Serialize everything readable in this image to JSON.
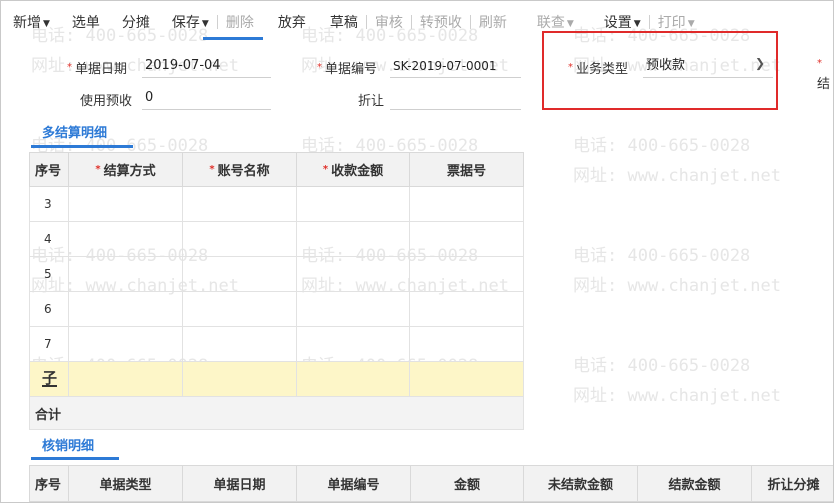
{
  "toolbar": {
    "items": [
      {
        "label": "新增",
        "caret": true,
        "disabled": false
      },
      {
        "label": "选单",
        "caret": false,
        "disabled": false
      },
      {
        "label": "分摊",
        "caret": false,
        "disabled": false
      },
      {
        "label": "保存",
        "caret": true,
        "disabled": false
      },
      {
        "label": "删除",
        "caret": false,
        "disabled": true
      },
      {
        "label": "放弃",
        "caret": false,
        "disabled": false
      },
      {
        "label": "草稿",
        "caret": false,
        "disabled": false
      },
      {
        "label": "审核",
        "caret": false,
        "disabled": true
      },
      {
        "label": "转预收",
        "caret": false,
        "disabled": true
      },
      {
        "label": "刷新",
        "caret": false,
        "disabled": true
      },
      {
        "label": "联查",
        "caret": true,
        "disabled": true
      },
      {
        "label": "设置",
        "caret": true,
        "disabled": false
      },
      {
        "label": "打印",
        "caret": true,
        "disabled": true
      }
    ]
  },
  "form": {
    "date_label": "单据日期",
    "date_value": "2019-07-04",
    "number_label": "单据编号",
    "number_value": "SK-2019-07-0001",
    "biz_type_label": "业务类型",
    "biz_type_value": "预收款",
    "use_prepay_label": "使用预收",
    "use_prepay_value": "0",
    "discount_label": "折让",
    "discount_value": "",
    "cut_label": "结"
  },
  "settlement": {
    "title": "多结算明细",
    "columns": [
      {
        "label": "序号",
        "required": false
      },
      {
        "label": "结算方式",
        "required": true
      },
      {
        "label": "账号名称",
        "required": true
      },
      {
        "label": "收款金额",
        "required": true
      },
      {
        "label": "票据号",
        "required": false
      }
    ],
    "rows": [
      "3",
      "4",
      "5",
      "6",
      "7"
    ],
    "total_label": "合计"
  },
  "verification": {
    "title": "核销明细",
    "columns": [
      "序号",
      "单据类型",
      "单据日期",
      "单据编号",
      "金额",
      "未结款金额",
      "结款金额",
      "折让分摊"
    ]
  },
  "watermark": {
    "phone": "电话: 400-665-0028",
    "site": "网址: www.chanjet.net"
  },
  "colors": {
    "accent": "#2d7ad6",
    "required": "#e0302a",
    "highlight_box": "#e02a2a",
    "yellow_row": "#fdf6c8"
  }
}
